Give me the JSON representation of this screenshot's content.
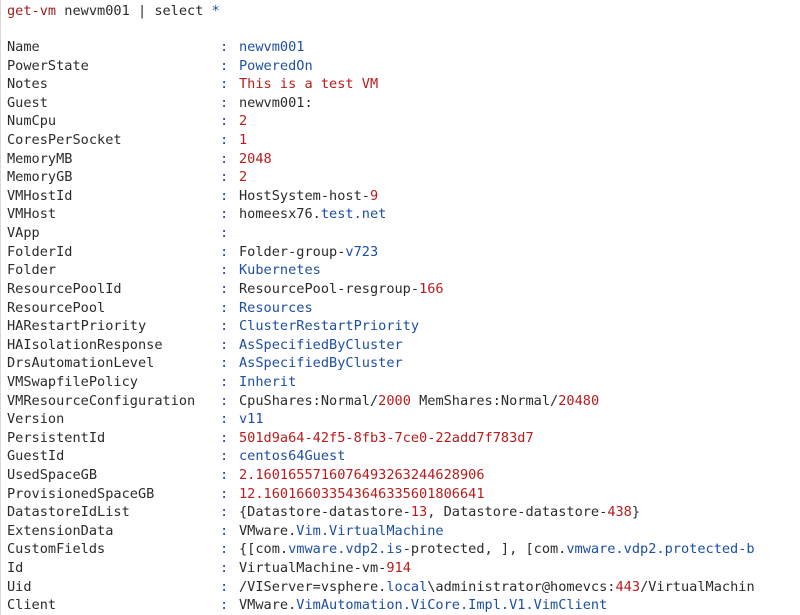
{
  "command": {
    "keyword": "get-vm",
    "rest": " newvm001 | select ",
    "star": "*"
  },
  "rows": [
    {
      "name": "Name",
      "value": [
        {
          "text": "newvm001",
          "c": "blue"
        }
      ]
    },
    {
      "name": "PowerState",
      "value": [
        {
          "text": "PoweredOn",
          "c": "blue"
        }
      ]
    },
    {
      "name": "Notes",
      "value": [
        {
          "text": "This is a test VM",
          "c": "red"
        }
      ]
    },
    {
      "name": "Guest",
      "value": [
        {
          "text": "newvm001:",
          "c": "dark"
        }
      ]
    },
    {
      "name": "NumCpu",
      "value": [
        {
          "text": "2",
          "c": "red"
        }
      ]
    },
    {
      "name": "CoresPerSocket",
      "value": [
        {
          "text": "1",
          "c": "red"
        }
      ]
    },
    {
      "name": "MemoryMB",
      "value": [
        {
          "text": "2048",
          "c": "red"
        }
      ]
    },
    {
      "name": "MemoryGB",
      "value": [
        {
          "text": "2",
          "c": "red"
        }
      ]
    },
    {
      "name": "VMHostId",
      "value": [
        {
          "text": "HostSystem-host-",
          "c": "dark"
        },
        {
          "text": "9",
          "c": "red"
        }
      ]
    },
    {
      "name": "VMHost",
      "value": [
        {
          "text": "homeesx76.",
          "c": "dark"
        },
        {
          "text": "test",
          "c": "blue"
        },
        {
          "text": ".net",
          "c": "blue"
        }
      ]
    },
    {
      "name": "VApp",
      "value": []
    },
    {
      "name": "FolderId",
      "value": [
        {
          "text": "Folder-group-",
          "c": "dark"
        },
        {
          "text": "v723",
          "c": "blue"
        }
      ]
    },
    {
      "name": "Folder",
      "value": [
        {
          "text": "Kubernetes",
          "c": "blue"
        }
      ]
    },
    {
      "name": "ResourcePoolId",
      "value": [
        {
          "text": "ResourcePool-resgroup-",
          "c": "dark"
        },
        {
          "text": "166",
          "c": "red"
        }
      ]
    },
    {
      "name": "ResourcePool",
      "value": [
        {
          "text": "Resources",
          "c": "blue"
        }
      ]
    },
    {
      "name": "HARestartPriority",
      "value": [
        {
          "text": "ClusterRestartPriority",
          "c": "blue"
        }
      ]
    },
    {
      "name": "HAIsolationResponse",
      "value": [
        {
          "text": "AsSpecifiedByCluster",
          "c": "blue"
        }
      ]
    },
    {
      "name": "DrsAutomationLevel",
      "value": [
        {
          "text": "AsSpecifiedByCluster",
          "c": "blue"
        }
      ]
    },
    {
      "name": "VMSwapfilePolicy",
      "value": [
        {
          "text": "Inherit",
          "c": "blue"
        }
      ]
    },
    {
      "name": "VMResourceConfiguration",
      "value": [
        {
          "text": "CpuShares:Normal/",
          "c": "dark"
        },
        {
          "text": "2000",
          "c": "red"
        },
        {
          "text": " MemShares:Normal/",
          "c": "dark"
        },
        {
          "text": "20480",
          "c": "red"
        }
      ]
    },
    {
      "name": "Version",
      "value": [
        {
          "text": "v11",
          "c": "blue"
        }
      ]
    },
    {
      "name": "PersistentId",
      "value": [
        {
          "text": "501d9a64-42f5-8fb3-7ce0-22add7f783d7",
          "c": "red"
        }
      ]
    },
    {
      "name": "GuestId",
      "value": [
        {
          "text": "centos64Guest",
          "c": "blue"
        }
      ]
    },
    {
      "name": "UsedSpaceGB",
      "value": [
        {
          "text": "2.16016557160764932632446289",
          "c": "red"
        },
        {
          "text": "06",
          "c": "red"
        }
      ]
    },
    {
      "name": "ProvisionedSpaceGB",
      "value": [
        {
          "text": "12.1601660335436463356018066",
          "c": "red"
        },
        {
          "text": "41",
          "c": "red"
        }
      ]
    },
    {
      "name": "DatastoreIdList",
      "value": [
        {
          "text": "{Datastore-datastore-",
          "c": "dark"
        },
        {
          "text": "13",
          "c": "red"
        },
        {
          "text": ", Datastore-datastore-",
          "c": "dark"
        },
        {
          "text": "438",
          "c": "red"
        },
        {
          "text": "}",
          "c": "dark"
        }
      ]
    },
    {
      "name": "ExtensionData",
      "value": [
        {
          "text": "VMware.",
          "c": "dark"
        },
        {
          "text": "Vim.VirtualMachine",
          "c": "blue"
        }
      ]
    },
    {
      "name": "CustomFields",
      "value": [
        {
          "text": "{[com.",
          "c": "dark"
        },
        {
          "text": "vmware.vdp2.is",
          "c": "blue"
        },
        {
          "text": "-protected, ], [com.",
          "c": "dark"
        },
        {
          "text": "vmware.vdp2.protected-b",
          "c": "blue"
        }
      ]
    },
    {
      "name": "Id",
      "value": [
        {
          "text": "VirtualMachine-vm-",
          "c": "dark"
        },
        {
          "text": "914",
          "c": "red"
        }
      ]
    },
    {
      "name": "Uid",
      "value": [
        {
          "text": "/VIServer=vsphere.",
          "c": "dark"
        },
        {
          "text": "local",
          "c": "blue"
        },
        {
          "text": "\\administrator@homevcs:",
          "c": "dark"
        },
        {
          "text": "443",
          "c": "red"
        },
        {
          "text": "/VirtualMachin",
          "c": "dark"
        }
      ]
    },
    {
      "name": "Client",
      "value": [
        {
          "text": "VMware.",
          "c": "dark"
        },
        {
          "text": "VimAutomation.ViCore.Impl.V1.VimClient",
          "c": "blue"
        }
      ]
    }
  ],
  "separator": ":"
}
